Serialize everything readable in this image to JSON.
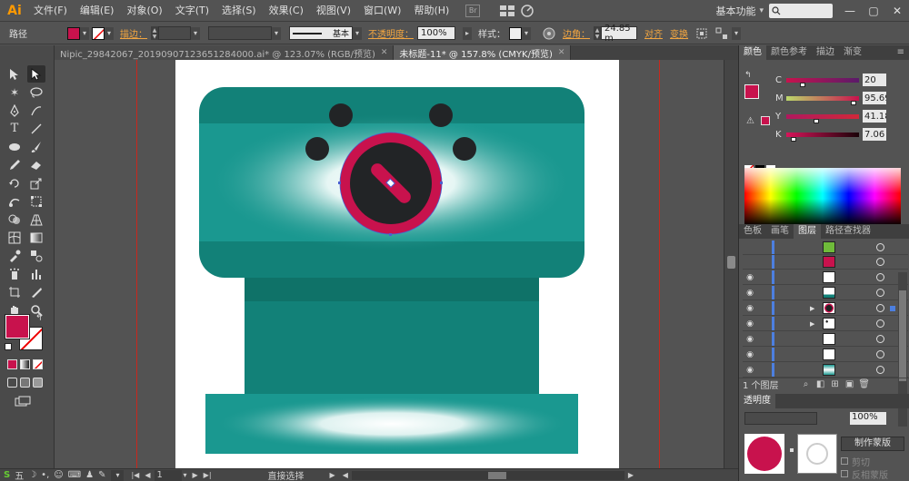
{
  "app": {
    "logo": "Ai",
    "workspace": "基本功能",
    "workspace_caret": "▾"
  },
  "menu": {
    "items": [
      "文件(F)",
      "编辑(E)",
      "对象(O)",
      "文字(T)",
      "选择(S)",
      "效果(C)",
      "视图(V)",
      "窗口(W)",
      "帮助(H)"
    ]
  },
  "window_controls": {
    "minimize": "—",
    "restore": "▢",
    "close": "✕"
  },
  "control_bar": {
    "selection_type": "路径",
    "fill_color": "#c8124d",
    "stroke_label": "描边：",
    "stroke_style_label": "基本",
    "opacity_label": "不透明度：",
    "opacity_value": "100%",
    "style_label": "样式：",
    "corner_label": "边角：",
    "corner_value": "24.85 m",
    "align_label": "对齐",
    "transform_label": "变换"
  },
  "tabs": [
    {
      "label": "Nipic_29842067_20190907123651284000.ai* @ 123.07% (RGB/预览)",
      "active": false,
      "close": "✕"
    },
    {
      "label": "未标题-11* @ 157.8% (CMYK/预览)",
      "active": true,
      "close": "✕"
    }
  ],
  "status": {
    "zoom": "157.8%",
    "page": "1",
    "tool": "直接选择",
    "ime_label": "五",
    "ime_icons": [
      "☽",
      "•,",
      "☺",
      "⌨",
      "♟",
      "✎"
    ]
  },
  "color_panel": {
    "tabs": [
      "颜色",
      "颜色参考",
      "描边",
      "渐变"
    ],
    "channels": [
      {
        "name": "C",
        "value": "20",
        "percent": 20
      },
      {
        "name": "M",
        "value": "95.69",
        "percent": 95.69
      },
      {
        "name": "Y",
        "value": "41.18",
        "percent": 41.18
      },
      {
        "name": "K",
        "value": "7.06",
        "percent": 7.06
      }
    ],
    "fill_color": "#c8124d",
    "out_of_gamut_color": "#c8124d",
    "out_of_gamut_icon": "⚠",
    "menu_icon": "≡"
  },
  "layers_panel": {
    "tabs": [
      "色板",
      "画笔",
      "图层",
      "路径查找器"
    ],
    "rows_visible": [
      false,
      false,
      true,
      true,
      true,
      true,
      true,
      true,
      true
    ],
    "count": "1 个图层",
    "expand_icon": "▶",
    "eye_icon": "◉"
  },
  "transparency_panel": {
    "tab": "透明度",
    "opacity": "100%",
    "mask_button": "制作蒙版",
    "clip": "剪切",
    "invert_mask": "反相蒙版"
  },
  "artwork": {
    "teal_dark": "#128178",
    "teal_mid": "#1a9890",
    "teal_band": "#0f7268",
    "accent": "#c8124d",
    "knob": "#222426"
  }
}
